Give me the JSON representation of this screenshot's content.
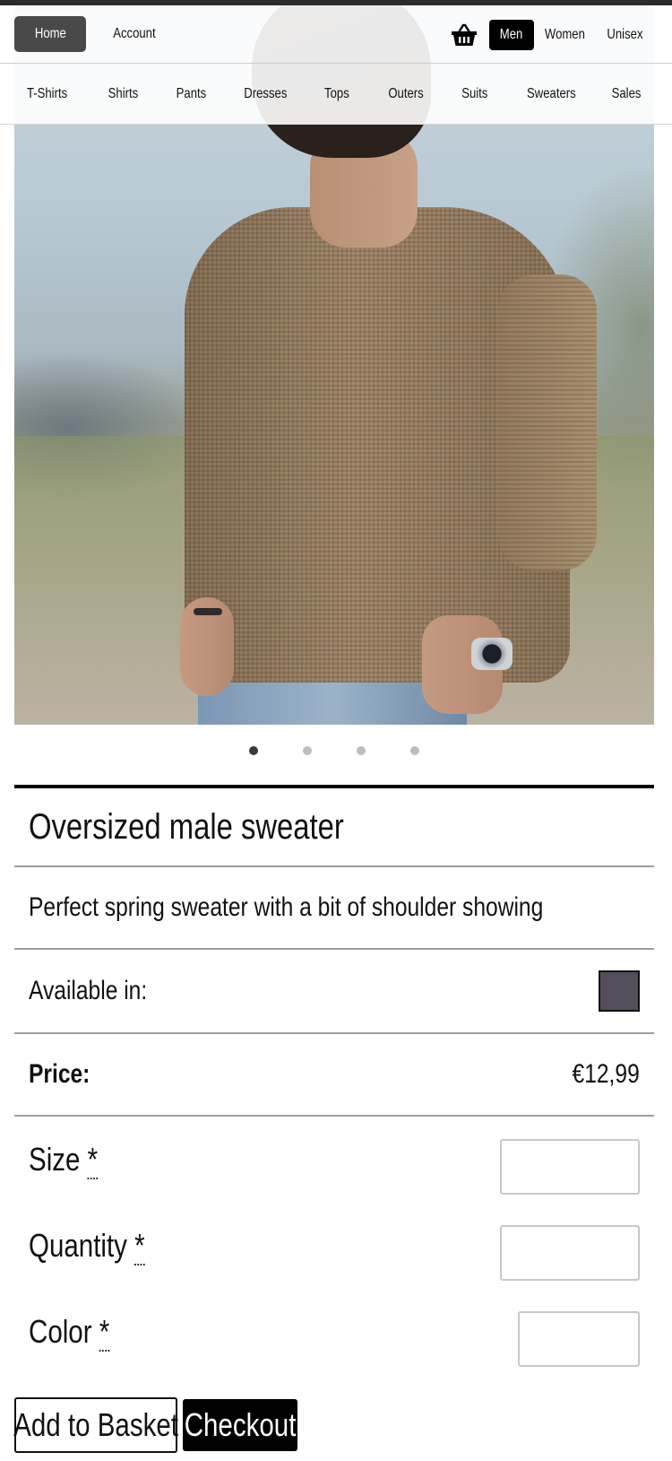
{
  "header": {
    "home_label": "Home",
    "account_label": "Account",
    "basket_icon": "basket-icon",
    "genders": [
      {
        "label": "Men",
        "active": true
      },
      {
        "label": "Women",
        "active": false
      },
      {
        "label": "Unisex",
        "active": false
      }
    ]
  },
  "categories": [
    "T-Shirts",
    "Shirts",
    "Pants",
    "Dresses",
    "Tops",
    "Outers",
    "Suits",
    "Sweaters",
    "Sales"
  ],
  "carousel": {
    "count": 4,
    "active_index": 0
  },
  "product": {
    "title": "Oversized male sweater",
    "description": "Perfect spring sweater with a bit of shoulder showing",
    "available_label": "Available in:",
    "swatch_color": "#544d5b",
    "price_label": "Price:",
    "price_value": "€12,99"
  },
  "form": {
    "size_label": "Size",
    "quantity_label": "Quantity",
    "color_label": "Color",
    "required_marker": "*",
    "size_value": "",
    "quantity_value": "",
    "color_value": ""
  },
  "actions": {
    "add_to_basket": "Add to Basket",
    "checkout": "Checkout"
  }
}
